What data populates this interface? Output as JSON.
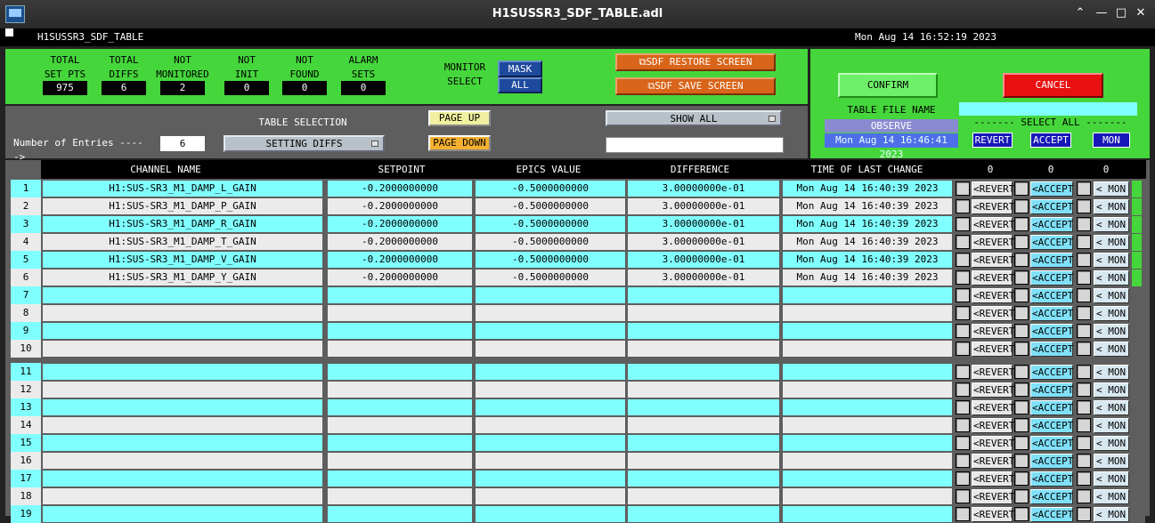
{
  "window": {
    "title": "H1SUSSR3_SDF_TABLE.adl"
  },
  "header": {
    "screen_name": "H1SUSSR3_SDF_TABLE",
    "datetime": "Mon Aug 14 16:52:19 2023"
  },
  "stats": [
    {
      "label": "TOTAL\nSET PTS",
      "value": "975"
    },
    {
      "label": "TOTAL\nDIFFS",
      "value": "6"
    },
    {
      "label": "NOT\nMONITORED",
      "value": "2"
    },
    {
      "label": "NOT\nINIT",
      "value": "0"
    },
    {
      "label": "NOT\nFOUND",
      "value": "0"
    },
    {
      "label": "ALARM\nSETS",
      "value": "0"
    }
  ],
  "monitor_select": {
    "label": "MONITOR\nSELECT",
    "mask": "MASK",
    "all": "ALL"
  },
  "buttons": {
    "restore": "⧉SDF RESTORE SCREEN",
    "save": "⧉SDF SAVE SCREEN",
    "confirm": "CONFIRM",
    "cancel": "CANCEL",
    "page_up": "PAGE UP",
    "page_down": "PAGE DOWN",
    "show_all": "SHOW ALL",
    "revert_all": "REVERT",
    "accept_all": "ACCEPT",
    "mon_all": "MON"
  },
  "table_selection": {
    "label": "TABLE SELECTION",
    "value": "SETTING DIFFS"
  },
  "entries": {
    "label": "Number of Entries ----->",
    "value": "6"
  },
  "table_file": {
    "label": "TABLE FILE NAME",
    "value": "",
    "mode": "OBSERVE",
    "loaded": "Mon Aug 14 16:46:41 2023",
    "select_all": "------- SELECT ALL -------"
  },
  "columns": {
    "channel": "CHANNEL NAME",
    "setpoint": "SETPOINT",
    "epics": "EPICS VALUE",
    "difference": "DIFFERENCE",
    "time": "TIME OF LAST CHANGE",
    "count_revert": "0",
    "count_accept": "0",
    "count_mon": "0"
  },
  "row_buttons": {
    "revert": "<REVERT",
    "accept": "<ACCEPT",
    "mon": "< MON"
  },
  "rows": [
    {
      "n": "1",
      "channel": "H1:SUS-SR3_M1_DAMP_L_GAIN",
      "setpoint": "-0.2000000000",
      "epics": "-0.5000000000",
      "diff": "3.00000000e-01",
      "time": "Mon Aug 14 16:40:39 2023"
    },
    {
      "n": "2",
      "channel": "H1:SUS-SR3_M1_DAMP_P_GAIN",
      "setpoint": "-0.2000000000",
      "epics": "-0.5000000000",
      "diff": "3.00000000e-01",
      "time": "Mon Aug 14 16:40:39 2023"
    },
    {
      "n": "3",
      "channel": "H1:SUS-SR3_M1_DAMP_R_GAIN",
      "setpoint": "-0.2000000000",
      "epics": "-0.5000000000",
      "diff": "3.00000000e-01",
      "time": "Mon Aug 14 16:40:39 2023"
    },
    {
      "n": "4",
      "channel": "H1:SUS-SR3_M1_DAMP_T_GAIN",
      "setpoint": "-0.2000000000",
      "epics": "-0.5000000000",
      "diff": "3.00000000e-01",
      "time": "Mon Aug 14 16:40:39 2023"
    },
    {
      "n": "5",
      "channel": "H1:SUS-SR3_M1_DAMP_V_GAIN",
      "setpoint": "-0.2000000000",
      "epics": "-0.5000000000",
      "diff": "3.00000000e-01",
      "time": "Mon Aug 14 16:40:39 2023"
    },
    {
      "n": "6",
      "channel": "H1:SUS-SR3_M1_DAMP_Y_GAIN",
      "setpoint": "-0.2000000000",
      "epics": "-0.5000000000",
      "diff": "3.00000000e-01",
      "time": "Mon Aug 14 16:40:39 2023"
    },
    {
      "n": "7",
      "channel": "",
      "setpoint": "",
      "epics": "",
      "diff": "",
      "time": ""
    },
    {
      "n": "8",
      "channel": "",
      "setpoint": "",
      "epics": "",
      "diff": "",
      "time": ""
    },
    {
      "n": "9",
      "channel": "",
      "setpoint": "",
      "epics": "",
      "diff": "",
      "time": ""
    },
    {
      "n": "10",
      "channel": "",
      "setpoint": "",
      "epics": "",
      "diff": "",
      "time": ""
    },
    {
      "n": "11",
      "channel": "",
      "setpoint": "",
      "epics": "",
      "diff": "",
      "time": ""
    },
    {
      "n": "12",
      "channel": "",
      "setpoint": "",
      "epics": "",
      "diff": "",
      "time": ""
    },
    {
      "n": "13",
      "channel": "",
      "setpoint": "",
      "epics": "",
      "diff": "",
      "time": ""
    },
    {
      "n": "14",
      "channel": "",
      "setpoint": "",
      "epics": "",
      "diff": "",
      "time": ""
    },
    {
      "n": "15",
      "channel": "",
      "setpoint": "",
      "epics": "",
      "diff": "",
      "time": ""
    },
    {
      "n": "16",
      "channel": "",
      "setpoint": "",
      "epics": "",
      "diff": "",
      "time": ""
    },
    {
      "n": "17",
      "channel": "",
      "setpoint": "",
      "epics": "",
      "diff": "",
      "time": ""
    },
    {
      "n": "18",
      "channel": "",
      "setpoint": "",
      "epics": "",
      "diff": "",
      "time": ""
    },
    {
      "n": "19",
      "channel": "",
      "setpoint": "",
      "epics": "",
      "diff": "",
      "time": ""
    }
  ],
  "colors": {
    "cyan_row": "#80ffff",
    "gray_row": "#ebebeb",
    "panel_green": "#45d63b",
    "panel_gray": "#5e5e5e",
    "diff_indicator": "#45d63b"
  }
}
